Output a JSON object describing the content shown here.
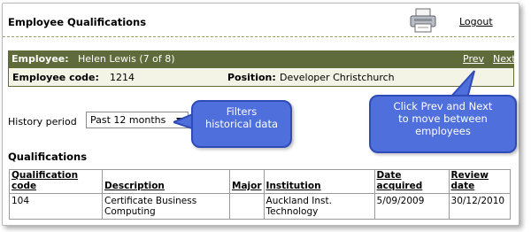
{
  "header": {
    "title": "Employee Qualifications",
    "logout_label": "Logout"
  },
  "employee_bar": {
    "label": "Employee:",
    "name": "Helen Lewis (7 of 8)",
    "prev_label": "Prev",
    "next_label": "Next"
  },
  "details": {
    "code_label": "Employee code:",
    "code_value": "1214",
    "position_label": "Position:",
    "position_value": "Developer Christchurch"
  },
  "history": {
    "label": "History period",
    "selected": "Past 12 months"
  },
  "qualifications": {
    "heading": "Qualifications",
    "columns": [
      "Qualification code",
      "Description",
      "Major",
      "Institution",
      "Date acquired",
      "Review date"
    ],
    "rows": [
      [
        "104",
        "Certificate Business Computing",
        "",
        "Auckland Inst. Technology",
        "5/09/2009",
        "30/12/2010"
      ]
    ]
  },
  "callouts": {
    "filters_line1": "Filters",
    "filters_line2": "historical data",
    "nav_line1": "Click Prev and Next",
    "nav_line2": "to move between",
    "nav_line3": "employees"
  },
  "colors": {
    "bar": "#5f6b3a",
    "callout": "#4f6fdc"
  }
}
